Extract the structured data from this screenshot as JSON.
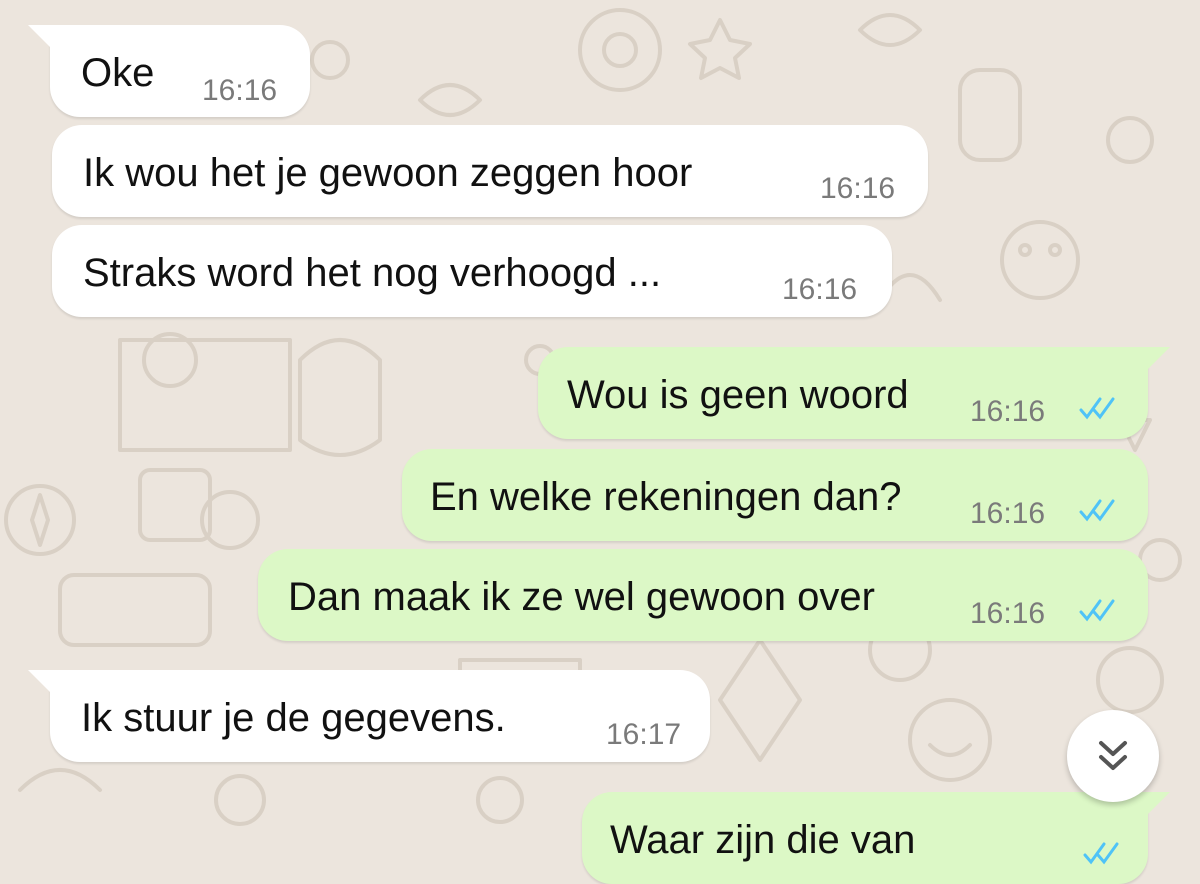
{
  "conversation": {
    "messages": [
      {
        "direction": "incoming",
        "text": "Oke",
        "time": "16:16"
      },
      {
        "direction": "incoming",
        "text": "Ik wou het je gewoon zeggen hoor",
        "time": "16:16"
      },
      {
        "direction": "incoming",
        "text": "Straks word het nog verhoogd ...",
        "time": "16:16"
      },
      {
        "direction": "outgoing",
        "text": "Wou is geen woord",
        "time": "16:16",
        "status": "read"
      },
      {
        "direction": "outgoing",
        "text": "En welke rekeningen dan?",
        "time": "16:16",
        "status": "read"
      },
      {
        "direction": "outgoing",
        "text": "Dan maak ik ze wel gewoon over",
        "time": "16:16",
        "status": "read"
      },
      {
        "direction": "incoming",
        "text": "Ik stuur je de gegevens.",
        "time": "16:17"
      },
      {
        "direction": "outgoing",
        "text": "Waar zijn die van",
        "time": "",
        "status": "read"
      }
    ]
  },
  "colors": {
    "background": "#ece5dd",
    "incoming_bubble": "#ffffff",
    "outgoing_bubble": "#dcf8c6",
    "timestamp": "#7a7a7a",
    "read_ticks": "#4fc3f7"
  },
  "controls": {
    "scroll_down_icon": "double-chevron-down-icon"
  }
}
